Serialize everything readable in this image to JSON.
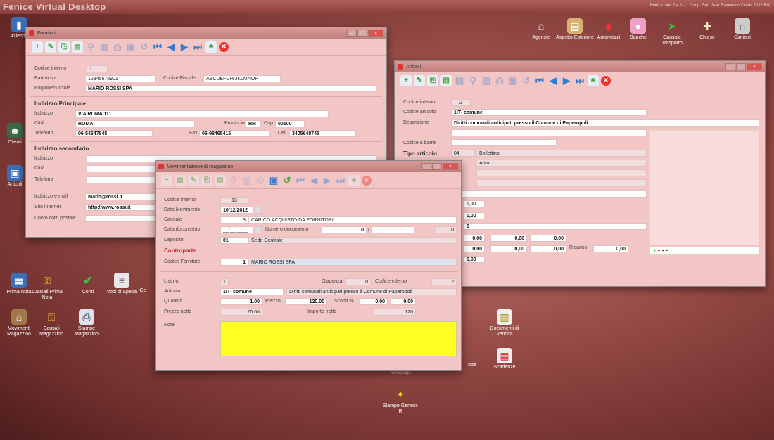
{
  "desktop": {
    "title": "Fenice Virtual Desktop",
    "credits": "Fenice .Net 2.4.1 - 1 Coop. Soc. San Francesco Onlus 2012  RIC"
  },
  "icons_left": [
    {
      "label": "Aziende"
    },
    {
      "label": "Clienti"
    },
    {
      "label": "Articoli"
    }
  ],
  "icons_bottom": [
    {
      "label": "Prima Nota"
    },
    {
      "label": "Causali Prima Nota"
    },
    {
      "label": "Conti"
    },
    {
      "label": "Voci di Spesa"
    },
    {
      "label": "Ce"
    },
    {
      "label": "Movimenti Magazzino"
    },
    {
      "label": "Causali Magazzino"
    },
    {
      "label": "Stampe Magazzino"
    }
  ],
  "icons_top_right": [
    {
      "label": "Agenzie"
    },
    {
      "label": "Aspetto Esteriore"
    },
    {
      "label": "Automezzi"
    },
    {
      "label": "Banche"
    },
    {
      "label": "Causale Trasporto"
    },
    {
      "label": "Chiese"
    },
    {
      "label": "Cimiteri"
    }
  ],
  "icons_center": [
    {
      "label": "Documenti di Vendita"
    },
    {
      "label": "Scadenze"
    },
    {
      "label": "nda"
    },
    {
      "label": "Stampe Genesi-R"
    },
    {
      "label": "Homepage"
    }
  ],
  "fornitori": {
    "title": "Fornitori",
    "codice_interno_label": "Codice interno",
    "codice_interno": "1",
    "piva_label": "Partita Iva",
    "piva": "12345678901",
    "cf_label": "Codice Fiscale",
    "cf": "ABCDEFGHIJKLMNOP",
    "rs_label": "Ragione/Sociale",
    "rs": "MARIO ROSSI SPA",
    "sec_principale": "Indirizzo Principale",
    "indirizzo_label": "Indirizzo",
    "indirizzo": "VIA ROMA 111",
    "citta_label": "Città",
    "citta": "ROMA",
    "prov_label": "Provincia",
    "prov": "RM",
    "cap_label": "Cap",
    "cap": "00100",
    "tel_label": "Telefono",
    "tel": "06-54647845",
    "fax_label": "Fax",
    "fax": "06-98465415",
    "cell_label": "Cell",
    "cell": "3405648745",
    "sec_secondario": "Indirizzo secondario",
    "indirizzo2_label": "Indirizzo",
    "citta2_label": "Città",
    "tel2_label": "Telefono",
    "email_label": "Indirizzo e-mail",
    "email": "mario@rossi.it",
    "sito_label": "Sito internet",
    "sito": "http://www.rossi.it",
    "ccp_label": "Conto corr. postale"
  },
  "articoli": {
    "title": "Articoli",
    "codice_interno_label": "Codice interno",
    "codice_interno": "2",
    "codice_articolo_label": "Codice articolo",
    "codice_articolo": "1IT- comune",
    "descrizione_label": "Descrizione",
    "descrizione": "Diritti comunali anticipati presso il Comune di Paperopoli",
    "barre_label": "Codice a barre",
    "tipo_label": "Tipo articolo",
    "tipo_code": "04",
    "tipo_desc": "Bollettino",
    "altro": "Altro",
    "v1": "0,00",
    "v2": "0,00",
    "v3": "0",
    "r1": [
      "0,00",
      "0,00",
      "0,00"
    ],
    "r2": [
      "0,00",
      "0,00",
      "0,00"
    ],
    "ricarico_label": "Ricarico",
    "ricarico": "0,00",
    "v4": "0,00"
  },
  "mov": {
    "title": "Movimentazione di magazzino",
    "codice_interno_label": "Codice interno",
    "codice_interno": "13",
    "data_mov_label": "Data Movimento",
    "data_mov": "10/12/2012",
    "causale_label": "Causale",
    "causale_code": "3",
    "causale_desc": "CARICO ACQUISTO DA FORNITORI",
    "data_doc_label": "Data documento",
    "data_doc": "__/__/____",
    "num_doc_label": "Numero documento",
    "num_doc": "0",
    "num_doc_sep": "/",
    "num_doc_right": "0",
    "deposito_label": "Deposito",
    "deposito_code": "01",
    "deposito_desc": "Sede Centrale",
    "controparte": "Controparte",
    "cod_forn_label": "Codice Fornitore",
    "cod_forn": "1",
    "cod_forn_desc": "MARIO ROSSI SPA",
    "listino_label": "Listino",
    "listino": "1",
    "giacenza_label": "Giacenza",
    "giacenza": "0",
    "ci_label": "Codice interno",
    "ci": "2",
    "articolo_label": "Articolo",
    "articolo": "1IT- comune",
    "articolo_desc": "Diritti comunali anticipati presso il Comune di Paperopoli",
    "quantita_label": "Quantità",
    "quantita": "1.00",
    "prezzo_label": "Prezzo",
    "prezzo": "120.00",
    "sconti_label": "Sconti %",
    "sconto1": "0.00",
    "sconto2": "0.00",
    "netto_label": "Prezzo netto",
    "netto": "120.00",
    "importo_label": "Importo netto",
    "importo": "120",
    "note_label": "Note",
    "note_color": "#ffff22"
  }
}
